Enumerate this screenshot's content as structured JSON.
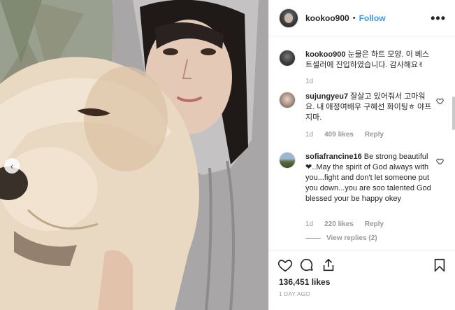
{
  "post": {
    "username": "kookoo900",
    "follow_label": "Follow",
    "separator": "•"
  },
  "caption": {
    "username": "kookoo900",
    "text": "눈물은 하트 모양. 이 베스트셀러에 진입하였습니다. 감사해요✌",
    "time": "1d"
  },
  "comments": [
    {
      "username": "sujungyeu7",
      "text": "잘살고 있어줘서 고마워요. 내 애정여배우 구혜선 화이팅ㅎ 야프지마.",
      "time": "1d",
      "likes": "409 likes",
      "reply_label": "Reply"
    },
    {
      "username": "sofiafrancine16",
      "text": "Be strong beautiful ❤..May the spirit of God always with you...fight and don't let someone put you down...you are soo talented God blessed your be happy okey",
      "time": "1d",
      "likes": "220 likes",
      "reply_label": "Reply",
      "view_replies": "View replies (2)"
    }
  ],
  "actions": {
    "likes_count": "136,451 likes",
    "date": "1 DAY AGO"
  },
  "icons": {
    "like": "heart-icon",
    "comment": "comment-icon",
    "share": "share-icon",
    "save": "bookmark-icon",
    "more": "more-options-icon",
    "carousel": "chevron-left-icon"
  },
  "colors": {
    "accent": "#3897f0",
    "text": "#262626",
    "muted": "#999999",
    "border": "#efefef"
  }
}
